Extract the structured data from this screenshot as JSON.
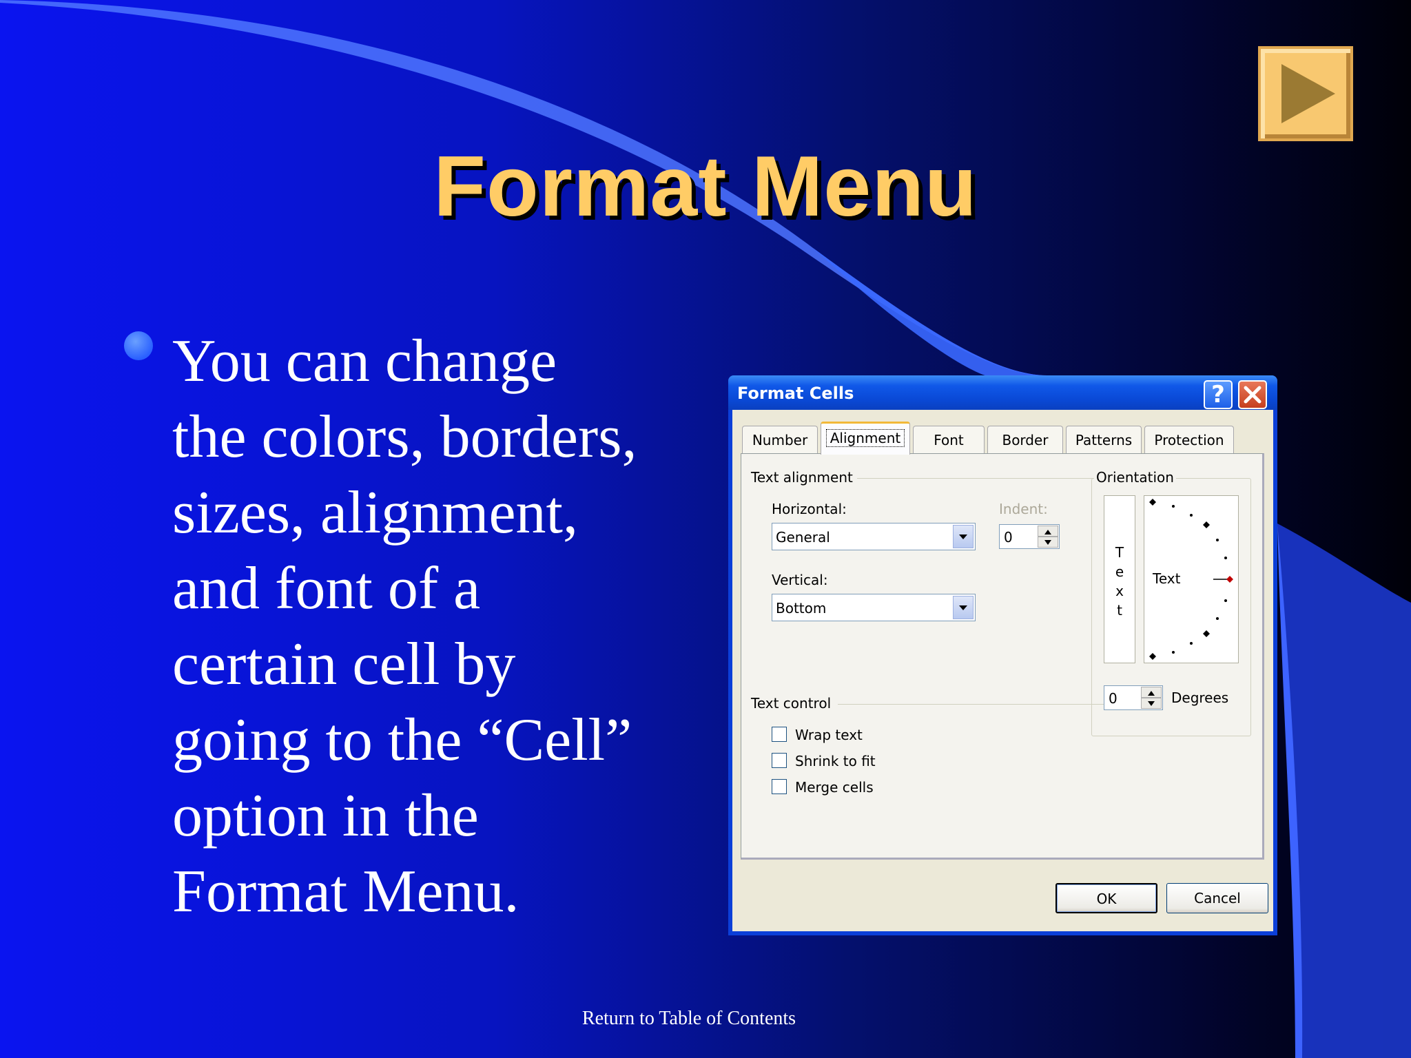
{
  "slide": {
    "title": "Format Menu",
    "bullet_lines": [
      "You can change",
      "the colors, borders,",
      "sizes, alignment,",
      "and font of a",
      "certain cell by",
      "going to the “Cell”",
      "option in the",
      "Format Menu."
    ],
    "footer_link": "Return to Table of Contents",
    "colors": {
      "title": "#ffcc66",
      "background_left": "#0a14f0",
      "background_right": "#000008",
      "nav_button": "#f8c870"
    },
    "nav_icon": "play-arrow-icon"
  },
  "dialog": {
    "title": "Format Cells",
    "help_icon": "help-icon",
    "close_icon": "close-icon",
    "tabs": [
      "Number",
      "Alignment",
      "Font",
      "Border",
      "Patterns",
      "Protection"
    ],
    "active_tab": "Alignment",
    "text_alignment": {
      "group_label": "Text alignment",
      "horizontal_label": "Horizontal:",
      "horizontal_value": "General",
      "indent_label": "Indent:",
      "indent_value": "0",
      "vertical_label": "Vertical:",
      "vertical_value": "Bottom"
    },
    "orientation": {
      "group_label": "Orientation",
      "vertical_text": [
        "T",
        "e",
        "x",
        "t"
      ],
      "dial_text": "Text",
      "degrees_value": "0",
      "degrees_label": "Degrees"
    },
    "text_control": {
      "group_label": "Text control",
      "wrap_text": {
        "label": "Wrap text",
        "checked": false
      },
      "shrink_to_fit": {
        "label": "Shrink to fit",
        "checked": false
      },
      "merge_cells": {
        "label": "Merge cells",
        "checked": false
      }
    },
    "ok_label": "OK",
    "cancel_label": "Cancel"
  }
}
